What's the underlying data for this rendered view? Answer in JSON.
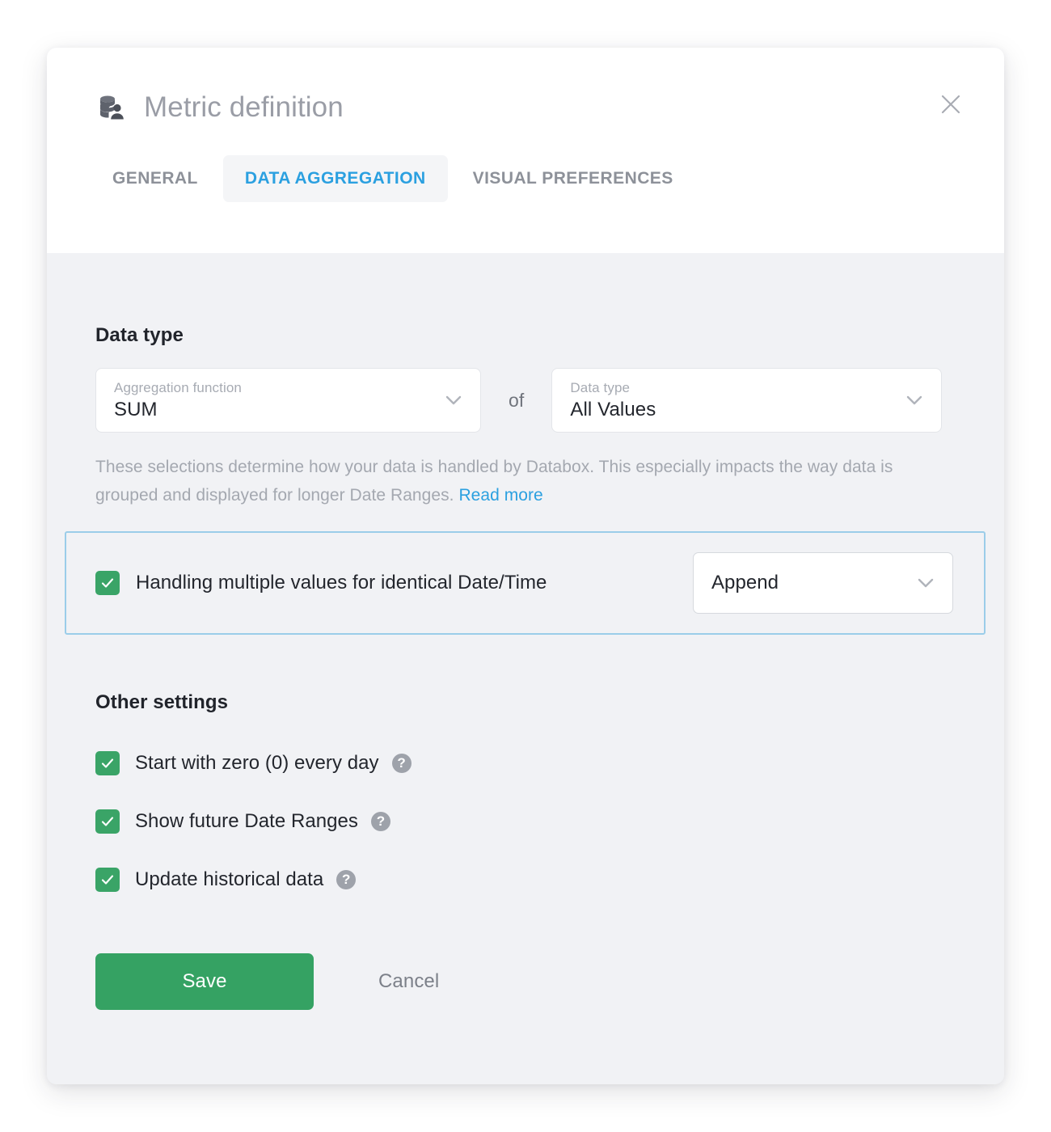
{
  "modal": {
    "title": "Metric definition",
    "title_icon": "database-user-icon",
    "close_icon": "close-icon"
  },
  "tabs": [
    {
      "label": "GENERAL",
      "active": false
    },
    {
      "label": "DATA AGGREGATION",
      "active": true
    },
    {
      "label": "VISUAL PREFERENCES",
      "active": false
    }
  ],
  "data_type_section": {
    "heading": "Data type",
    "aggregation_select": {
      "label": "Aggregation function",
      "value": "SUM",
      "chevron_icon": "chevron-down-icon"
    },
    "separator": "of",
    "data_type_select": {
      "label": "Data type",
      "value": "All Values",
      "chevron_icon": "chevron-down-icon"
    },
    "helper_text": "These selections determine how your data is handled by Databox. This especially impacts the way data is grouped and displayed for longer Date Ranges.",
    "helper_link": "Read more"
  },
  "highlight": {
    "checkbox_checked": true,
    "label": "Handling multiple values for identical Date/Time",
    "select_value": "Append",
    "chevron_icon": "chevron-down-icon"
  },
  "other_settings": {
    "heading": "Other settings",
    "options": [
      {
        "label": "Start with zero (0) every day",
        "checked": true,
        "help": "?"
      },
      {
        "label": "Show future Date Ranges",
        "checked": true,
        "help": "?"
      },
      {
        "label": "Update historical data",
        "checked": true,
        "help": "?"
      }
    ]
  },
  "footer": {
    "save_label": "Save",
    "cancel_label": "Cancel"
  },
  "colors": {
    "accent_blue": "#2ba0e0",
    "green": "#35a263",
    "checkbox_green": "#3aa467",
    "highlight_border": "#9bcde9",
    "body_bg": "#f1f2f5",
    "text_dark": "#23262d",
    "text_muted": "#a4a8b0"
  }
}
